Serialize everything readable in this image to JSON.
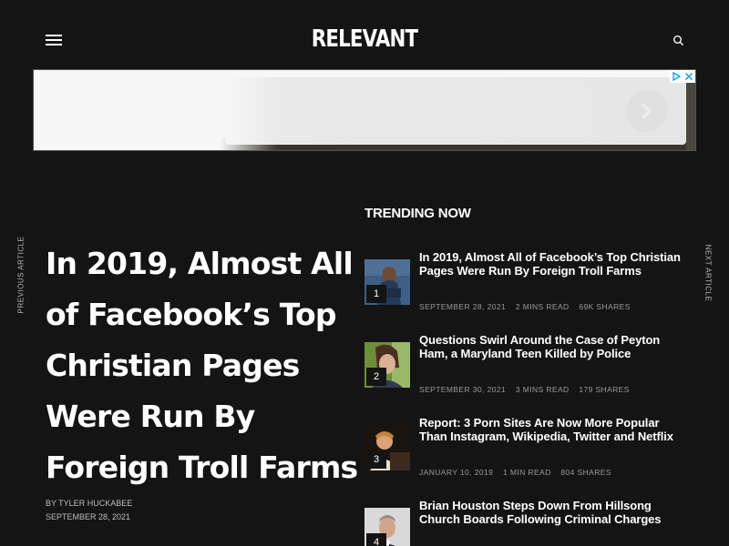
{
  "header": {
    "logo": "RELEVANT",
    "menu_icon": "hamburger-menu-icon",
    "search_icon": "search-icon"
  },
  "ad": {
    "choices_icon": "adchoices-icon",
    "close_icon": "close-icon",
    "next_icon": "chevron-right-icon"
  },
  "nav": {
    "previous": "PREVIOUS ARTICLE",
    "next": "NEXT ARTICLE"
  },
  "article": {
    "title": "In 2019, Almost All of Facebook’s Top Christian Pages Were Run By Foreign Troll Farms",
    "byline": "BY TYLER HUCKABEE",
    "date": "SEPTEMBER 28, 2021"
  },
  "trending": {
    "heading": "TRENDING NOW",
    "items": [
      {
        "number": "1",
        "title": "In 2019, Almost All of Facebook’s Top Christian Pages Were Run By Foreign Troll Farms",
        "date": "SEPTEMBER 28, 2021",
        "read": "2 MINS READ",
        "shares": "69K SHARES"
      },
      {
        "number": "2",
        "title": "Questions Swirl Around the Case of Peyton Ham, a Maryland Teen Killed by Police",
        "date": "SEPTEMBER 30, 2021",
        "read": "3 MINS READ",
        "shares": "179 SHARES"
      },
      {
        "number": "3",
        "title": "Report: 3 Porn Sites Are Now More Popular Than Instagram, Wikipedia, Twitter and Netflix",
        "date": "JANUARY 10, 2019",
        "read": "1 MIN READ",
        "shares": "804 SHARES"
      },
      {
        "number": "4",
        "title": "Brian Houston Steps Down From Hillsong Church Boards Following Criminal Charges",
        "date": "",
        "read": "",
        "shares": ""
      }
    ]
  },
  "colors": {
    "background": "#141414",
    "text": "#ffffff",
    "muted": "#9a9a9a"
  }
}
